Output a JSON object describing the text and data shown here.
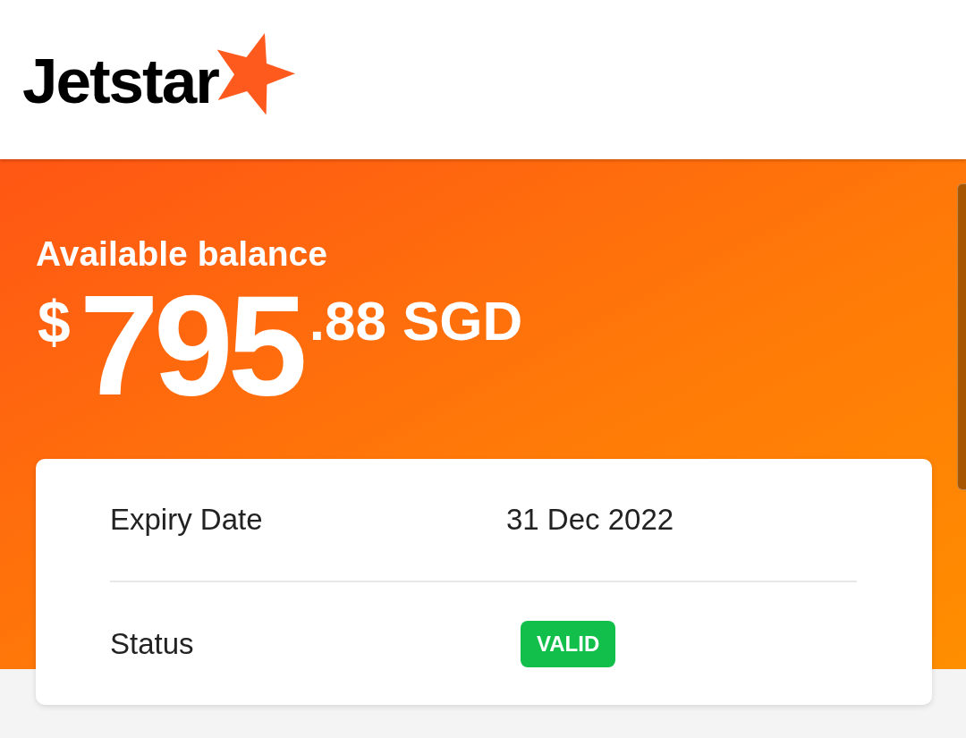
{
  "header": {
    "logo_text": "Jetstar"
  },
  "balance": {
    "label": "Available balance",
    "currency_symbol": "$",
    "whole": "795",
    "cents": ".88",
    "currency": "SGD"
  },
  "details": [
    {
      "kind": "text",
      "label": "Expiry Date",
      "value": "31 Dec 2022"
    },
    {
      "kind": "badge",
      "label": "Status",
      "value": "VALID"
    }
  ]
}
